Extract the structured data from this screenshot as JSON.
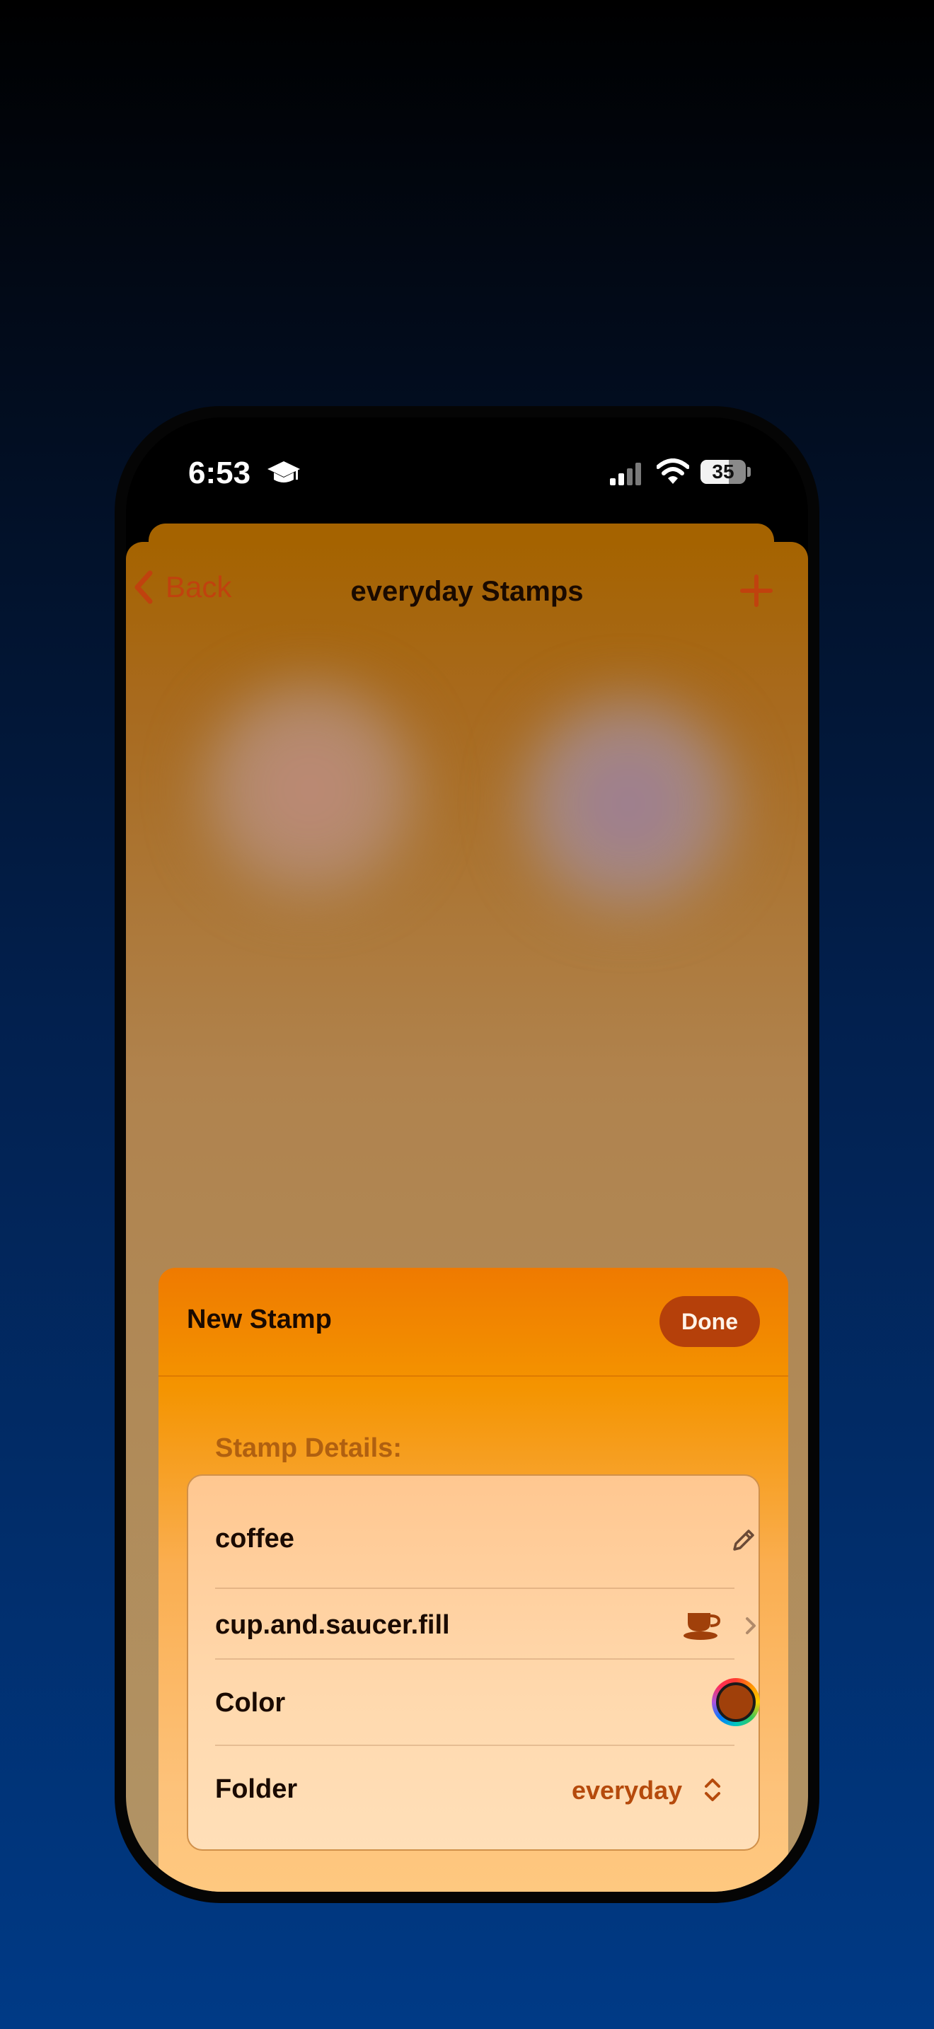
{
  "status_bar": {
    "time": "6:53",
    "battery": "35",
    "icons": [
      "graduation-cap-icon",
      "cellular-signal-icon",
      "wifi-icon",
      "battery-icon"
    ]
  },
  "navbar": {
    "back_label": "Back",
    "title": "everyday Stamps",
    "add_icon": "plus-icon"
  },
  "sheet": {
    "title": "New Stamp",
    "done_label": "Done",
    "section_label": "Stamp Details:",
    "rows": {
      "name": {
        "value": "coffee",
        "icon": "pencil-icon"
      },
      "symbol": {
        "value": "cup.and.saucer.fill",
        "icon": "cup-and-saucer-icon"
      },
      "color": {
        "label": "Color",
        "swatch": "#a0400a"
      },
      "folder": {
        "label": "Folder",
        "value": "everyday"
      }
    }
  },
  "colors": {
    "accent": "#c0420e",
    "sheet_top": "#ef7a00",
    "sheet_bottom": "#ffcf86",
    "done_button": "#b5400a"
  }
}
